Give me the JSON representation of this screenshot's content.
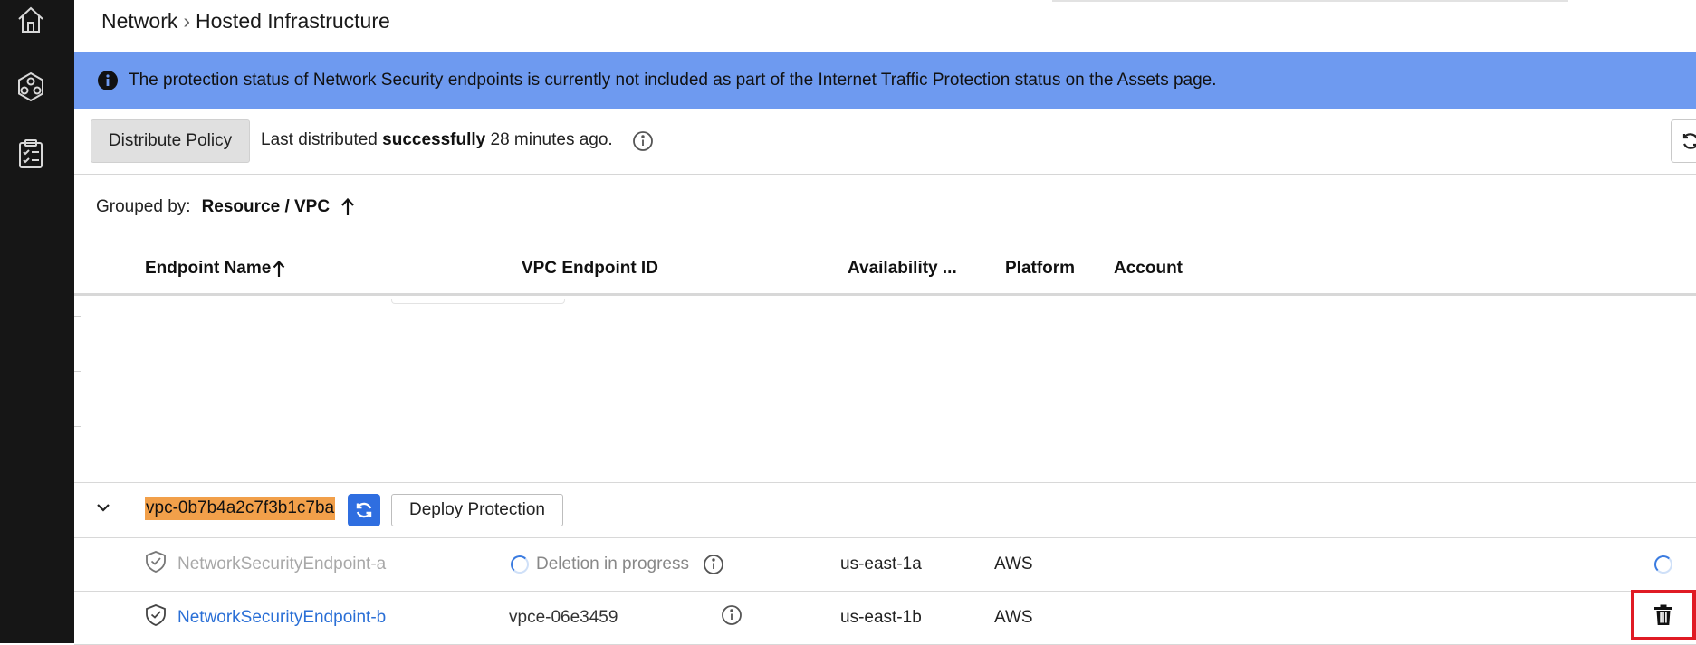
{
  "breadcrumb": {
    "parent": "Network",
    "separator": "›",
    "current": "Hosted Infrastructure"
  },
  "banner": {
    "text": "The protection status of Network Security endpoints is currently not included as part of the Internet Traffic Protection status on the Assets page.",
    "color": "#6e9af0"
  },
  "toolbar": {
    "distribute_label": "Distribute Policy",
    "status_prefix": "Last distributed",
    "status_bold": "successfully",
    "status_suffix": "28 minutes ago."
  },
  "grouping": {
    "label": "Grouped by:",
    "value": "Resource / VPC"
  },
  "columns": {
    "endpoint_name": "Endpoint Name",
    "vpc_endpoint_id": "VPC Endpoint ID",
    "availability": "Availability ...",
    "platform": "Platform",
    "account": "Account"
  },
  "group": {
    "vpc_id": "vpc-0b7b4a2c7f3b1c7ba",
    "deploy_label": "Deploy Protection",
    "highlight_color": "#f2a04a"
  },
  "rows": [
    {
      "name": "NetworkSecurityEndpoint-a",
      "status": "Deletion in progress",
      "az": "us-east-1a",
      "platform": "AWS"
    },
    {
      "name": "NetworkSecurityEndpoint-b",
      "vpce": "vpce-06e3459",
      "az": "us-east-1b",
      "platform": "AWS"
    }
  ],
  "icons": {
    "nav": [
      "home-icon",
      "hexagon-network-icon",
      "clipboard-checklist-icon"
    ]
  }
}
